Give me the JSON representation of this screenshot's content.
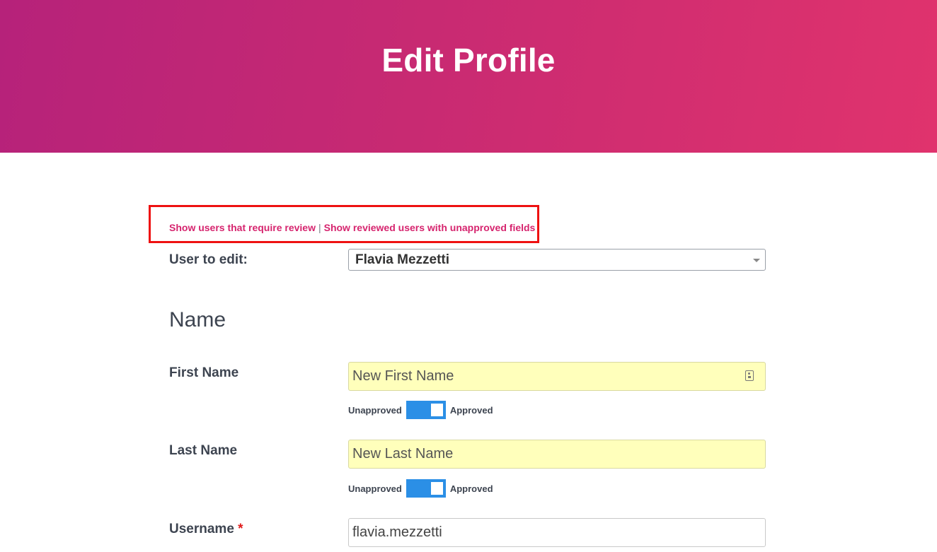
{
  "header": {
    "title": "Edit Profile"
  },
  "review": {
    "link_require_review": "Show users that require review",
    "separator": "|",
    "link_unapproved_fields": "Show reviewed users with unapproved fields"
  },
  "user_select": {
    "label": "User to edit:",
    "value": "Flavia Mezzetti"
  },
  "section": {
    "title": "Name"
  },
  "fields": {
    "first_name": {
      "label": "First Name",
      "placeholder": "New First Name",
      "value": "",
      "toggle_off": "Unapproved",
      "toggle_on": "Approved",
      "approved": true
    },
    "last_name": {
      "label": "Last Name",
      "placeholder": "New Last Name",
      "value": "",
      "toggle_off": "Unapproved",
      "toggle_on": "Approved",
      "approved": true
    },
    "username": {
      "label": "Username",
      "required_mark": "*",
      "value": "flavia.mezzetti"
    }
  },
  "colors": {
    "accent": "#d6246e",
    "toggle": "#2b8fe6",
    "highlight_box": "#ee1111",
    "field_yellow": "#ffffbb"
  }
}
